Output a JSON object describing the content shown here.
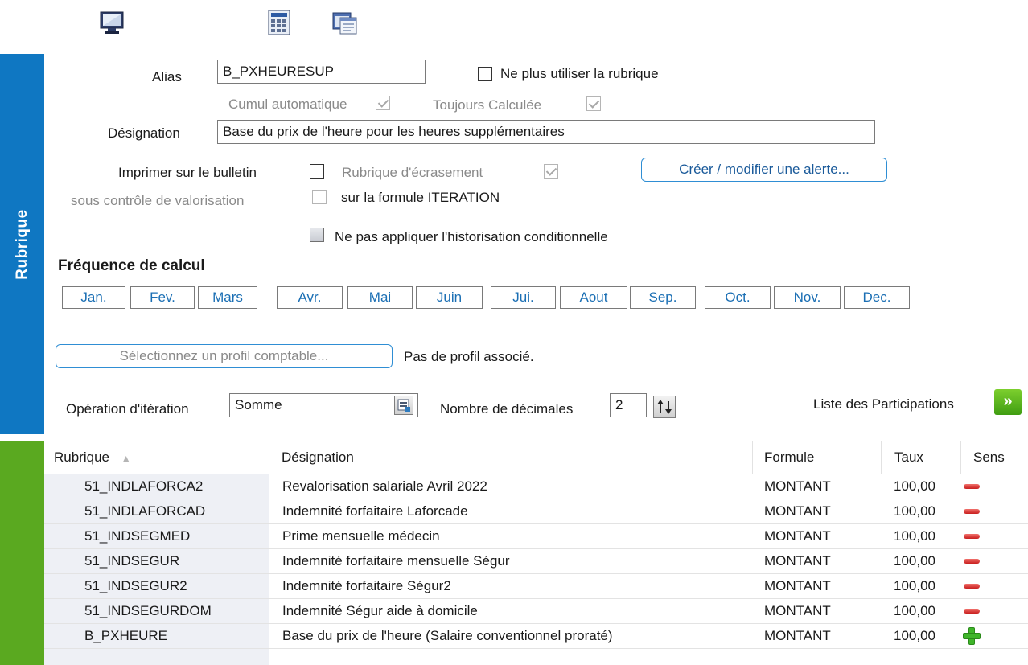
{
  "toolbar": {
    "icons": [
      "monitor-icon",
      "calculator-icon",
      "window-icon"
    ]
  },
  "sidebar": {
    "top_label": "Rubrique",
    "top_color": "#0f77c2",
    "bottom_color": "#5aa920"
  },
  "form": {
    "alias_label": "Alias",
    "alias_value": "B_PXHEURESUP",
    "no_longer_use_label": "Ne plus utiliser la rubrique",
    "cumul_auto_label": "Cumul automatique",
    "always_calc_label": "Toujours Calculée",
    "designation_label": "Désignation",
    "designation_value": "Base du prix de l'heure pour les heures supplémentaires",
    "print_label": "Imprimer sur le bulletin",
    "control_label": "sous contrôle de valorisation",
    "override_label": "Rubrique d'écrasement",
    "iteration_formula_label": "sur la formule ITERATION",
    "alert_button": "Créer / modifier une alerte...",
    "no_history_label": "Ne pas appliquer l'historisation conditionnelle"
  },
  "frequency": {
    "title": "Fréquence de calcul",
    "months": [
      "Jan.",
      "Fev.",
      "Mars",
      "Avr.",
      "Mai",
      "Juin",
      "Jui.",
      "Aout",
      "Sep.",
      "Oct.",
      "Nov.",
      "Dec."
    ]
  },
  "profile": {
    "button": "Sélectionnez un profil comptable...",
    "status": "Pas de profil associé."
  },
  "iteration": {
    "op_label": "Opération d'itération",
    "op_value": "Somme",
    "decimals_label": "Nombre de décimales",
    "decimals_value": "2",
    "participations_label": "Liste des Participations",
    "participations_button": "»"
  },
  "grid": {
    "columns": [
      "Rubrique",
      "Désignation",
      "Formule",
      "Taux",
      "Sens"
    ],
    "sort_indicator": "▲",
    "rows": [
      {
        "rubrique": "51_INDLAFORCA2",
        "designation": "Revalorisation salariale Avril 2022",
        "formule": "MONTANT",
        "taux": "100,00",
        "sens": "minus"
      },
      {
        "rubrique": "51_INDLAFORCAD",
        "designation": "Indemnité forfaitaire Laforcade",
        "formule": "MONTANT",
        "taux": "100,00",
        "sens": "minus"
      },
      {
        "rubrique": "51_INDSEGMED",
        "designation": "Prime mensuelle médecin",
        "formule": "MONTANT",
        "taux": "100,00",
        "sens": "minus"
      },
      {
        "rubrique": "51_INDSEGUR",
        "designation": "Indemnité forfaitaire mensuelle Ségur",
        "formule": "MONTANT",
        "taux": "100,00",
        "sens": "minus"
      },
      {
        "rubrique": "51_INDSEGUR2",
        "designation": "Indemnité forfaitaire Ségur2",
        "formule": "MONTANT",
        "taux": "100,00",
        "sens": "minus"
      },
      {
        "rubrique": "51_INDSEGURDOM",
        "designation": "Indemnité Ségur aide à domicile",
        "formule": "MONTANT",
        "taux": "100,00",
        "sens": "minus"
      },
      {
        "rubrique": "B_PXHEURE",
        "designation": "Base du prix de l'heure (Salaire conventionnel  proraté)",
        "formule": "MONTANT",
        "taux": "100,00",
        "sens": "plus"
      }
    ]
  }
}
